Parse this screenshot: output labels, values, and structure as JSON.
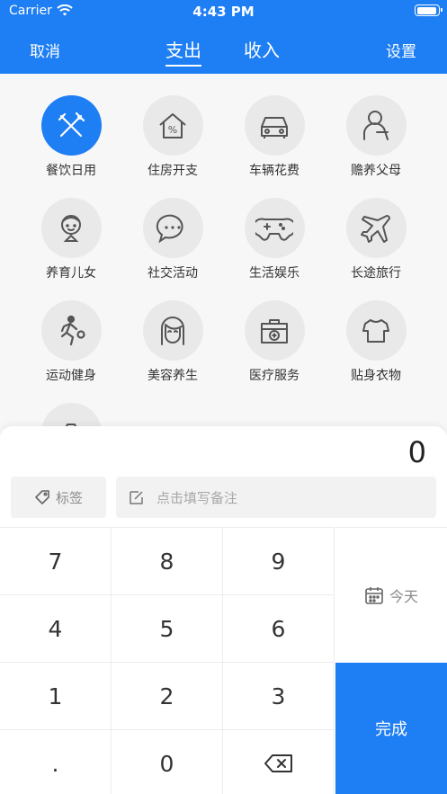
{
  "status_bar": {
    "carrier": "Carrier",
    "time": "4:43 PM",
    "battery_level": 0.95
  },
  "nav": {
    "cancel": "取消",
    "settings": "设置",
    "tabs": [
      {
        "label": "支出",
        "selected": true
      },
      {
        "label": "收入",
        "selected": false
      }
    ]
  },
  "categories": [
    {
      "label": "餐饮日用",
      "icon": "utensils-icon",
      "selected": true
    },
    {
      "label": "住房开支",
      "icon": "house-icon"
    },
    {
      "label": "车辆花费",
      "icon": "car-icon"
    },
    {
      "label": "赡养父母",
      "icon": "elder-icon"
    },
    {
      "label": "养育儿女",
      "icon": "child-icon"
    },
    {
      "label": "社交活动",
      "icon": "chat-bubble-icon"
    },
    {
      "label": "生活娱乐",
      "icon": "gamepad-icon"
    },
    {
      "label": "长途旅行",
      "icon": "airplane-icon"
    },
    {
      "label": "运动健身",
      "icon": "runner-icon"
    },
    {
      "label": "美容养生",
      "icon": "woman-face-icon"
    },
    {
      "label": "医疗服务",
      "icon": "medical-kit-icon"
    },
    {
      "label": "贴身衣物",
      "icon": "shirt-icon"
    },
    {
      "label": "",
      "icon": "camera-icon"
    }
  ],
  "entry": {
    "amount": "0",
    "tag_label": "标签",
    "note_placeholder": "点击填写备注",
    "keys": [
      "7",
      "8",
      "9",
      "4",
      "5",
      "6",
      "1",
      "2",
      "3",
      ".",
      "0"
    ],
    "date_label": "今天",
    "done_label": "完成"
  },
  "colors": {
    "accent": "#1e7ef3",
    "icon_bg": "#e9e9e9",
    "grid_bg": "#f7f7f7"
  }
}
